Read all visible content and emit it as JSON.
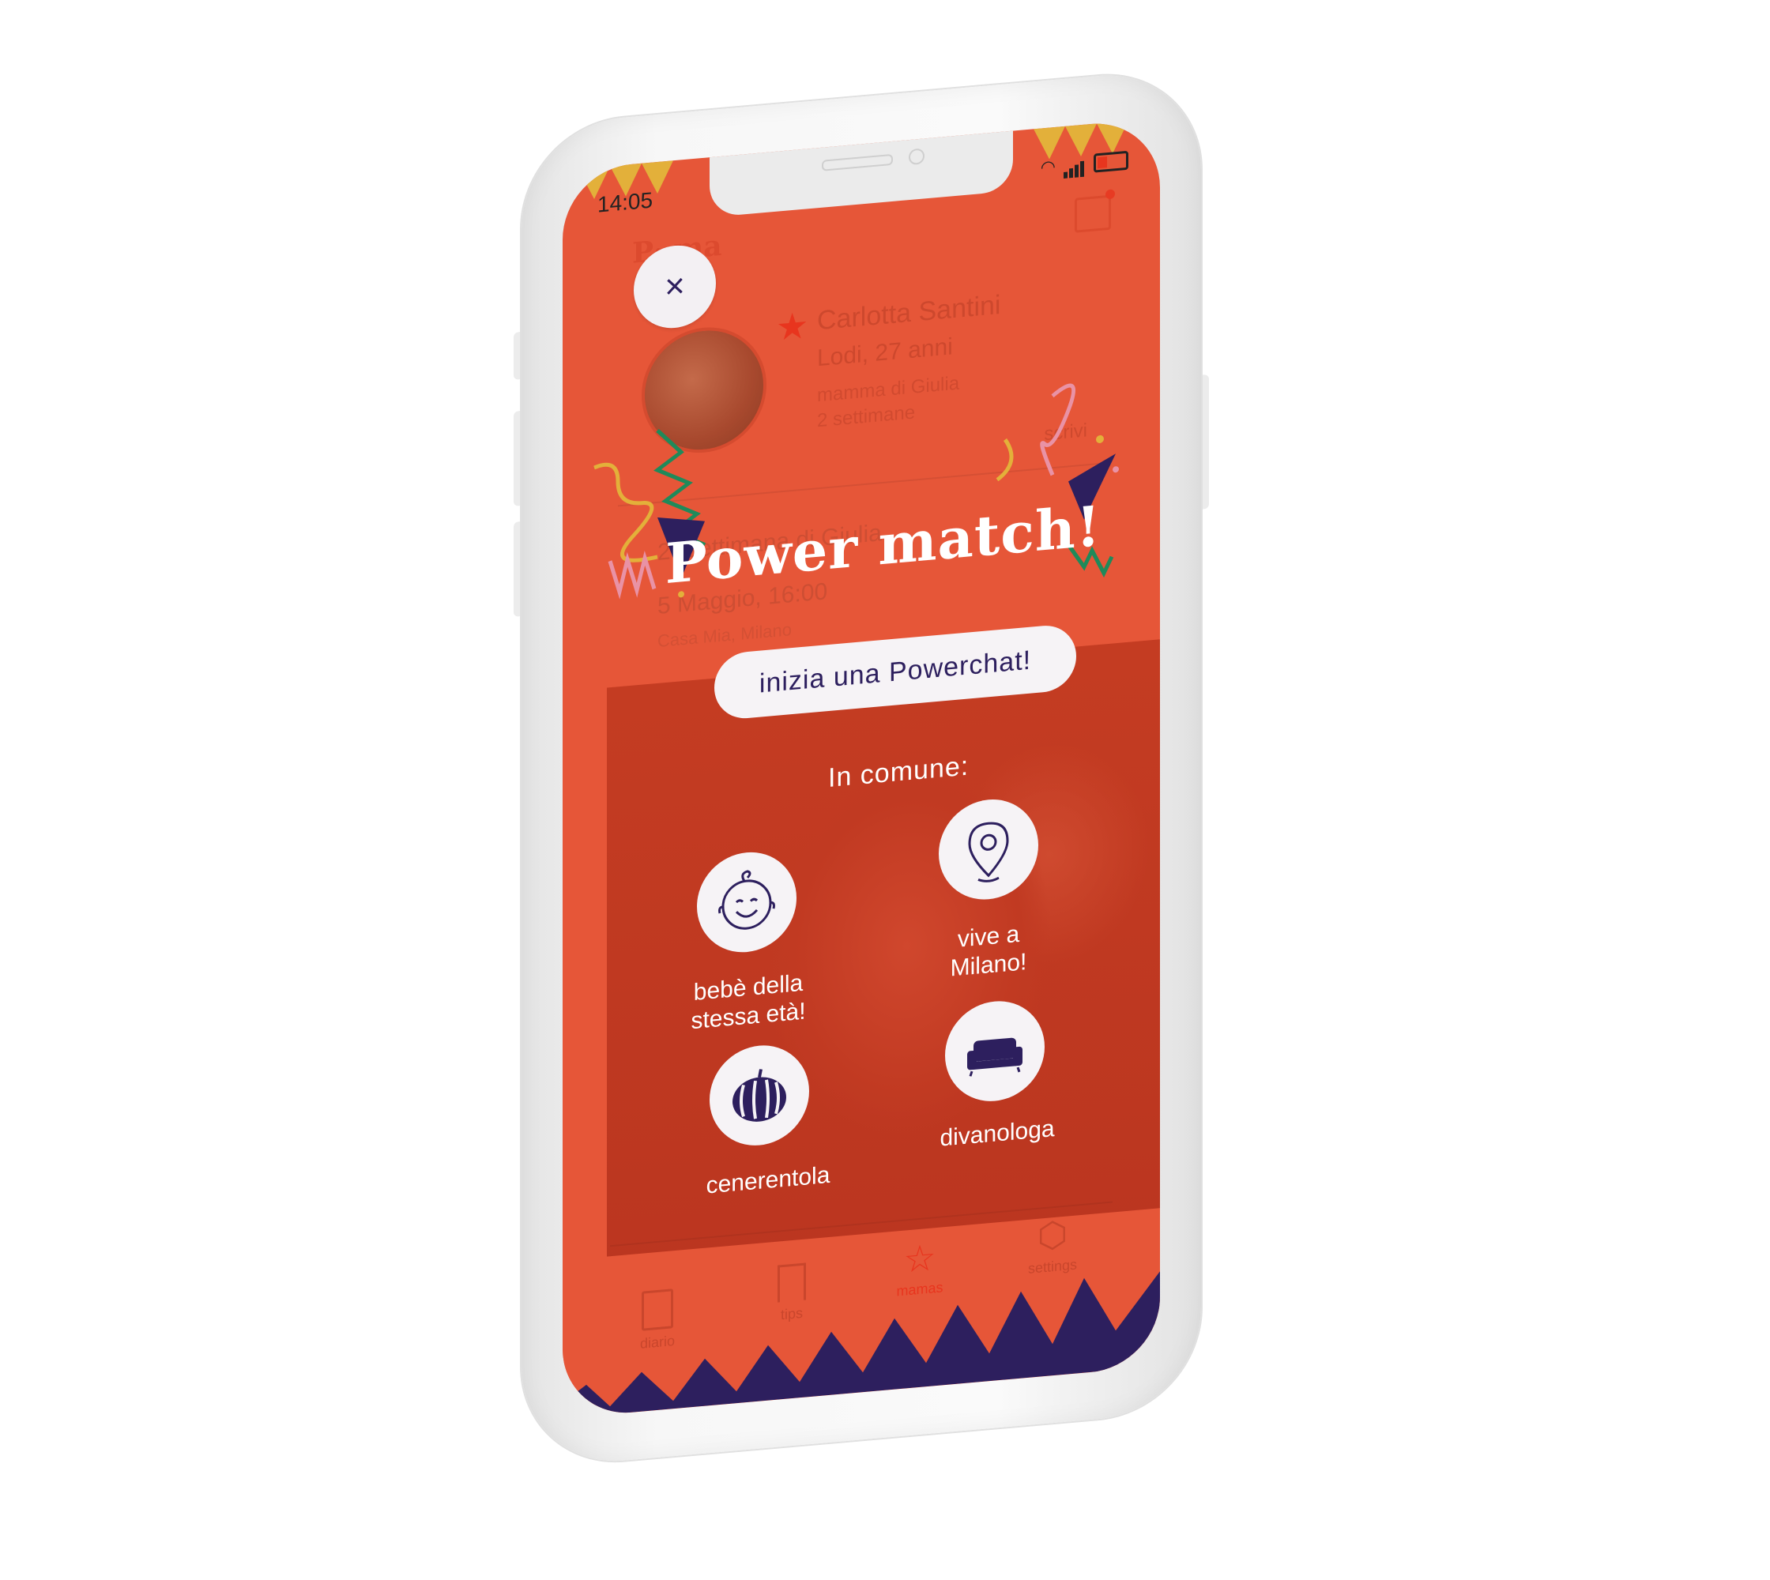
{
  "status": {
    "time": "14:05"
  },
  "background": {
    "profile_name": "Carlotta Santini",
    "profile_city_age": "Lodi, 27 anni",
    "profile_child": "mamma di Giulia",
    "profile_weeks": "2 settimane",
    "write_label": "scrivi",
    "event_title": "2° settimana di Giulia",
    "event_date": "5 Maggio, 16:00",
    "event_place": "Casa Mia, Milano"
  },
  "match": {
    "close_label": "×",
    "title": "Power match!",
    "cta_label": "inizia una Powerchat!",
    "common_label": "In comune:",
    "items": [
      {
        "icon": "baby-face-icon",
        "label_line1": "bebè della",
        "label_line2": "stessa età!"
      },
      {
        "icon": "location-pin-icon",
        "label_line1": "vive a",
        "label_line2": "Milano!"
      },
      {
        "icon": "pumpkin-icon",
        "label_line1": "cenerentola",
        "label_line2": ""
      },
      {
        "icon": "sofa-icon",
        "label_line1": "divanologa",
        "label_line2": ""
      }
    ]
  },
  "tabs": [
    {
      "label": "diario",
      "icon": "notebook-icon"
    },
    {
      "label": "tips",
      "icon": "bookmark-icon"
    },
    {
      "label": "mamas",
      "icon": "star-icon",
      "active": true
    },
    {
      "label": "settings",
      "icon": "hexagon-icon"
    }
  ],
  "colors": {
    "primary": "#e65638",
    "photo_overlay": "#c13a22",
    "accent_navy": "#2d1f5e",
    "bunting_yellow": "#e3b03a",
    "white": "#ffffff"
  }
}
